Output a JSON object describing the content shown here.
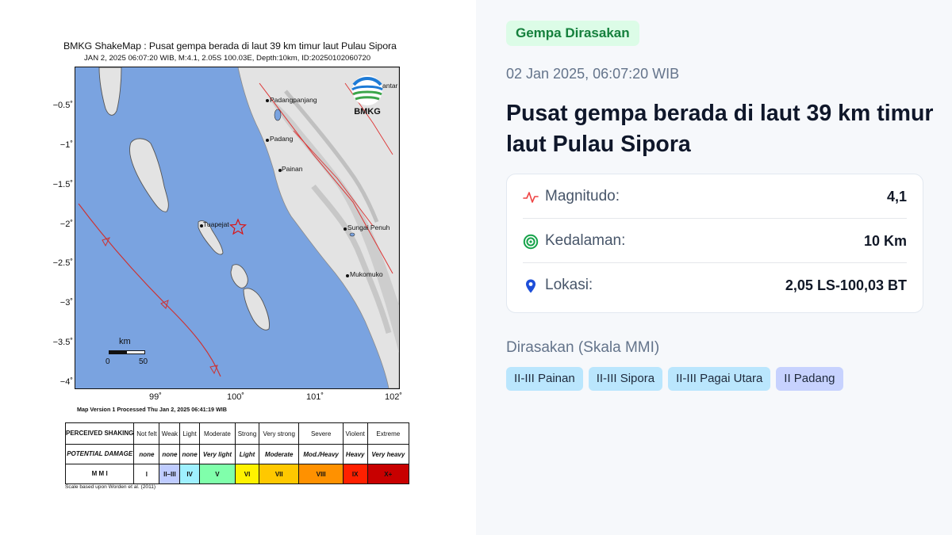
{
  "shakemap": {
    "title": "BMKG ShakeMap : Pusat gempa berada di laut 39 km timur laut Pulau Sipora",
    "subtitle": "JAN 2, 2025 06:07:20 WIB, M:4.1, 2.05S 100.03E, Depth:10km, ID:20250102060720",
    "y_ticks": [
      "−0.5˚",
      "−1˚",
      "−1.5˚",
      "−2˚",
      "−2.5˚",
      "−3˚",
      "−3.5˚",
      "−4˚"
    ],
    "x_ticks": [
      "99˚",
      "100˚",
      "101˚",
      "102˚"
    ],
    "places": {
      "padangpanjang": "Padangpanjang",
      "padang": "Padang",
      "painan": "Painan",
      "sungai_penuh": "Sungai Penuh",
      "mukomuko": "Mukomuko",
      "tuapejat": "Tuapejat",
      "pariaman_cut": "antar"
    },
    "logo_text": "BMKG",
    "scalebar": {
      "unit": "km",
      "zero": "0",
      "max": "50"
    },
    "map_version": "Map Version 1 Processed Thu Jan  2, 2025 06:41:19 WIB",
    "scale_credit": "Scale based upon Worden et al. (2011)",
    "mmi_table": {
      "shaking_header": "PERCEIVED SHAKING",
      "damage_header": "POTENTIAL DAMAGE",
      "mmi_header": "M M I",
      "shaking": [
        "Not felt",
        "Weak",
        "Light",
        "Moderate",
        "Strong",
        "Very strong",
        "Severe",
        "Violent",
        "Extreme"
      ],
      "damage": [
        "none",
        "none",
        "none",
        "Very light",
        "Light",
        "Moderate",
        "Mod./Heavy",
        "Heavy",
        "Very heavy"
      ],
      "mmi": [
        "I",
        "II–III",
        "IV",
        "V",
        "VI",
        "VII",
        "VIII",
        "IX",
        "X+"
      ],
      "mmi_colors": [
        "#ffffff",
        "#bfccff",
        "#9ff0ff",
        "#80ffab",
        "#fff200",
        "#ffc800",
        "#ff9100",
        "#ff2000",
        "#c80000"
      ]
    }
  },
  "info": {
    "badge": "Gempa Dirasakan",
    "datetime": "02 Jan 2025, 06:07:20 WIB",
    "headline": "Pusat gempa berada di laut 39 km timur laut Pulau Sipora",
    "rows": [
      {
        "icon": "pulse-icon",
        "label": "Magnitudo:",
        "value": "4,1"
      },
      {
        "icon": "target-icon",
        "label": "Kedalaman:",
        "value": "10 Km"
      },
      {
        "icon": "location-pin-icon",
        "label": "Lokasi:",
        "value": "2,05 LS-100,03 BT"
      }
    ],
    "felt_heading": "Dirasakan (Skala MMI)",
    "felt_areas": [
      {
        "label": "II-III Painan",
        "color": "#bae6fd"
      },
      {
        "label": "II-III Sipora",
        "color": "#bae6fd"
      },
      {
        "label": "II-III Pagai Utara",
        "color": "#bae6fd"
      },
      {
        "label": "II Padang",
        "color": "#c7d2fe"
      }
    ],
    "colors": {
      "badge_bg": "#dcfce7",
      "badge_text": "#15803d",
      "magnitude_icon": "#ef4444",
      "depth_icon": "#16a34a",
      "location_icon": "#1d4ed8"
    }
  }
}
